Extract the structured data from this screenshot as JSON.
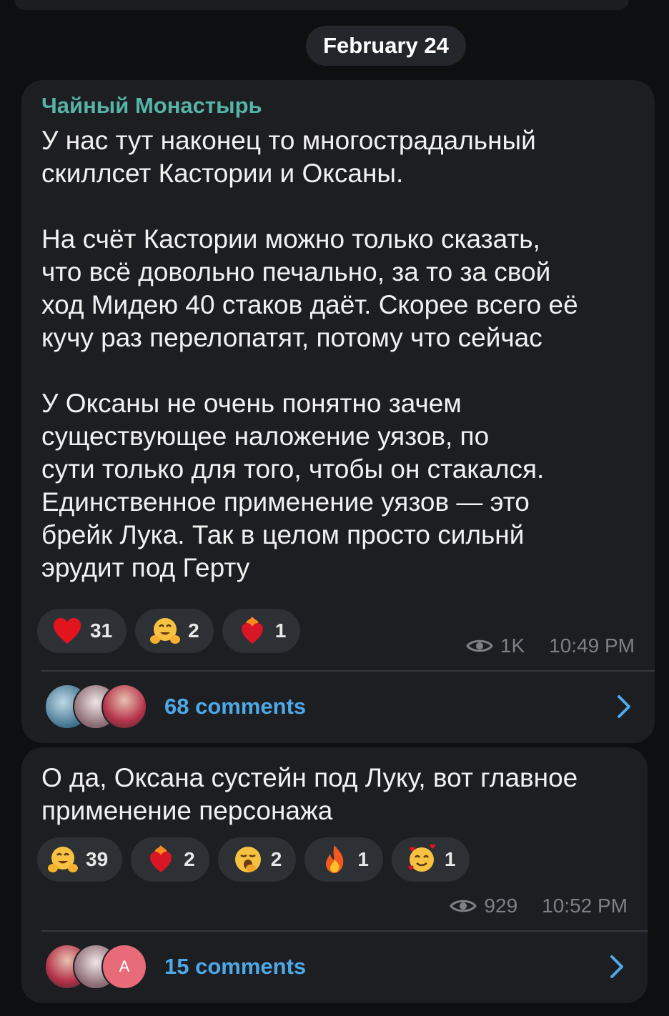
{
  "date_separator": "February 24",
  "posts": [
    {
      "channel_name": "Чайный Монастырь",
      "text": "У нас тут наконец то многострадальный\nскиллсет Кастории и Оксаны.\n\nНа счёт Кастории можно только сказать,\nчто всё довольно печально, за то за свой\nход Мидею 40 стаков даёт. Скорее всего её\nкучу раз перелопатят, потому что сейчас\n\nУ Оксаны не очень понятно зачем\nсуществующее наложение уязов, по\nсути только для того, чтобы он стакался.\nЕдинственное применение уязов — это\nбрейк Лука. Так в целом просто сильнй\nэрудит под Герту",
      "reactions": [
        {
          "icon": "red-heart-icon",
          "count": "31"
        },
        {
          "icon": "hugging-face-icon",
          "count": "2"
        },
        {
          "icon": "heart-on-fire-icon",
          "count": "1"
        }
      ],
      "views": "1K",
      "time": "10:49 PM",
      "comments_label": "68 comments"
    },
    {
      "text": "О да, Оксана сустейн под Луку, вот главное\nприменение персонажа",
      "reactions": [
        {
          "icon": "hugging-face-icon",
          "count": "39"
        },
        {
          "icon": "heart-on-fire-icon",
          "count": "2"
        },
        {
          "icon": "yawning-face-icon",
          "count": "2"
        },
        {
          "icon": "fire-icon",
          "count": "1"
        },
        {
          "icon": "smiling-face-with-hearts-icon",
          "count": "1"
        }
      ],
      "views": "929",
      "time": "10:52 PM",
      "comments_label": "15 comments",
      "avatar_letter": "A"
    }
  ]
}
